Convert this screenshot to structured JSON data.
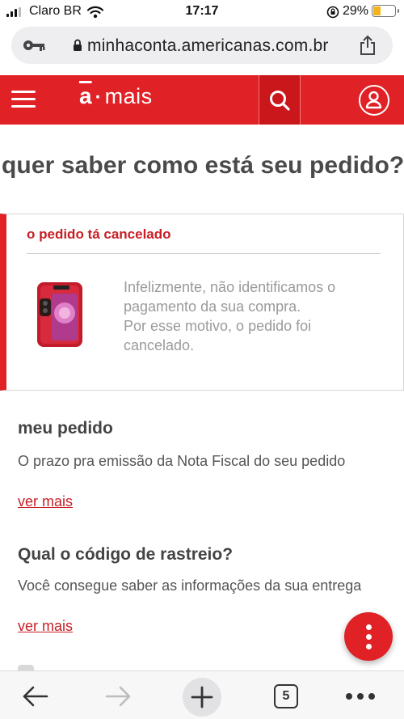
{
  "status_bar": {
    "carrier": "Claro BR",
    "time": "17:17",
    "battery_percent": "29%",
    "battery_level": 0.29
  },
  "browser": {
    "url": "minhaconta.americanas.com.br"
  },
  "header": {
    "logo_letter": "a",
    "logo_word": "mais",
    "brand_color": "#e02126"
  },
  "page": {
    "title": "quer saber como está seu pedido?"
  },
  "order_status": {
    "heading": "o pedido tá cancelado",
    "message_lines": [
      "Infelizmente, não identificamos o",
      "pagamento da sua compra.",
      "Por esse motivo, o pedido foi",
      "cancelado."
    ],
    "product_icon": "red-smartphone"
  },
  "sections": [
    {
      "title": "meu pedido",
      "text": "O prazo pra emissão da Nota Fiscal do seu pedido",
      "link": "ver mais"
    },
    {
      "title": "Qual o código de rastreio?",
      "text": "Você consegue saber as informações da sua entrega",
      "link": "ver mais"
    }
  ],
  "toolbar": {
    "tab_count": "5"
  }
}
